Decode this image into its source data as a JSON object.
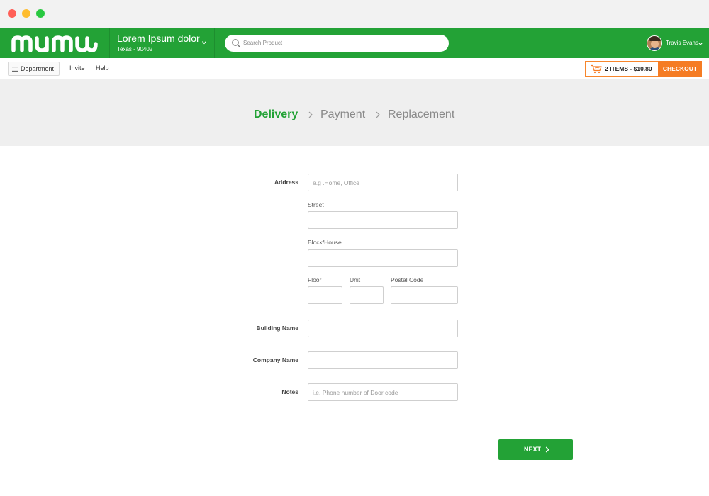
{
  "header": {
    "logo_text": "mumu",
    "location_name": "Lorem Ipsum dolor",
    "location_sub": "Texas - 90402",
    "search_placeholder": "Search Product",
    "user_name": "Travis Evans"
  },
  "subnav": {
    "department_label": "Department",
    "links": [
      "Invite",
      "Help"
    ],
    "cart_label": "2 ITEMS - $10.80",
    "checkout_label": "CHECKOUT"
  },
  "steps": [
    {
      "label": "Delivery",
      "active": true
    },
    {
      "label": "Payment",
      "active": false
    },
    {
      "label": "Replacement",
      "active": false
    }
  ],
  "form": {
    "address_label": "Address",
    "address_placeholder": "e.g .Home, Office",
    "street_label": "Street",
    "block_label": "Block/House",
    "floor_label": "Floor",
    "unit_label": "Unit",
    "postal_label": "Postal Code",
    "building_label": "Building Name",
    "company_label": "Company Name",
    "notes_label": "Notes",
    "notes_placeholder": "i.e. Phone number of Door code",
    "next_label": "NEXT"
  },
  "colors": {
    "brand_green": "#23a236",
    "accent_orange": "#f57c24",
    "banner_bg": "#efefef"
  }
}
